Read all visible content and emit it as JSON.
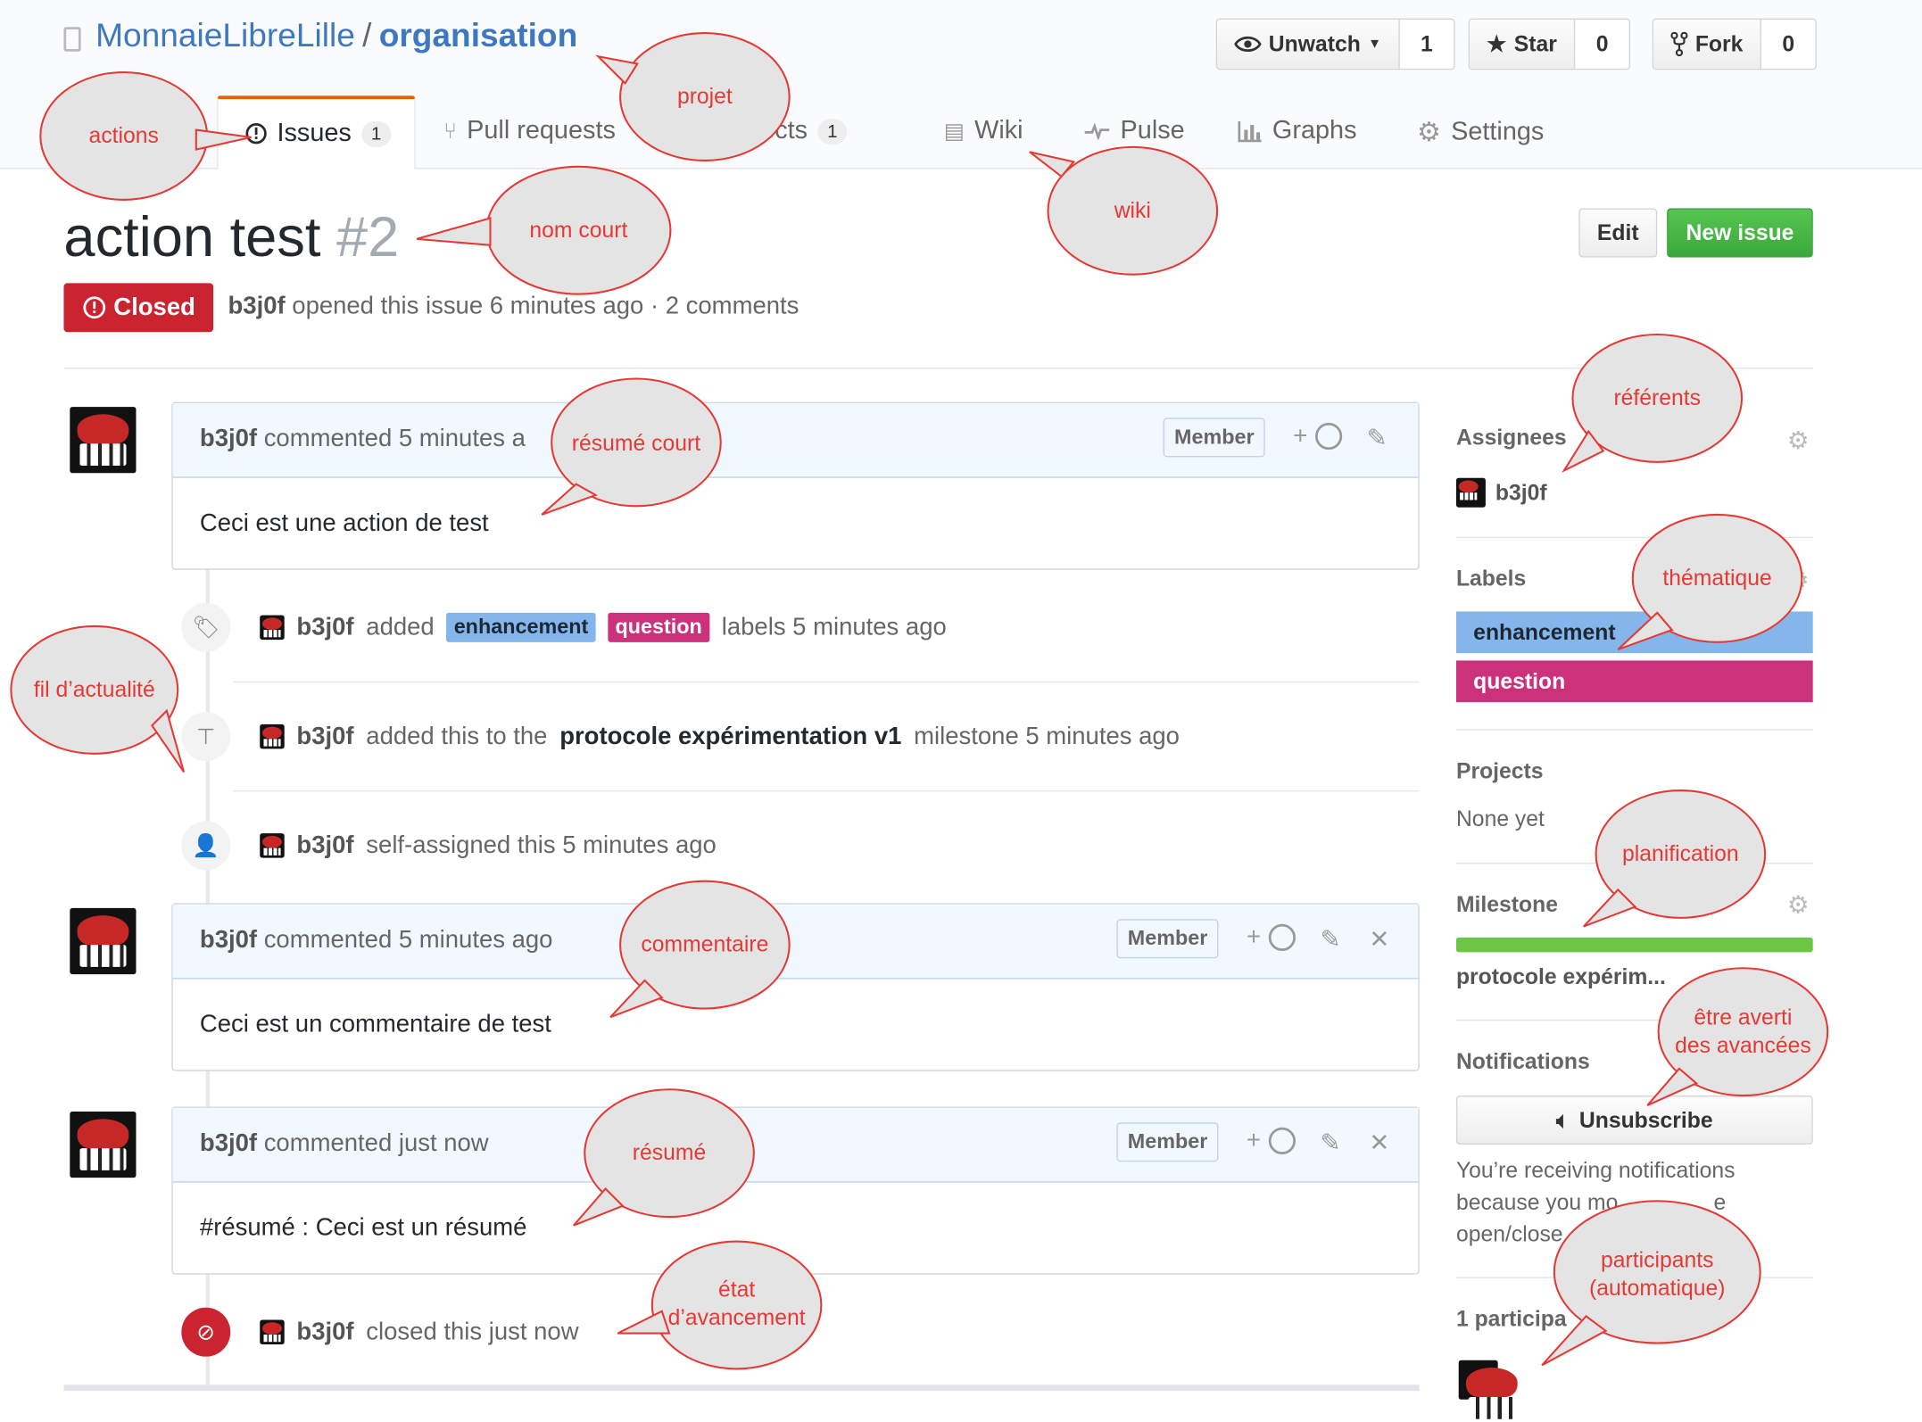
{
  "repo": {
    "owner": "MonnaieLibreLille",
    "separator": "/",
    "name": "organisation"
  },
  "actions": {
    "watch": {
      "label": "Unwatch",
      "count": "1"
    },
    "star": {
      "label": "Star",
      "count": "0"
    },
    "fork": {
      "label": "Fork",
      "count": "0"
    }
  },
  "tabs": [
    {
      "label": "Issues",
      "count": "1"
    },
    {
      "label": "Pull requests"
    },
    {
      "label": "Projects",
      "count": "1"
    },
    {
      "label": "Wiki"
    },
    {
      "label": "Pulse"
    },
    {
      "label": "Graphs"
    },
    {
      "label": "Settings"
    }
  ],
  "issue": {
    "title": "action test",
    "number": "#2",
    "state": "Closed",
    "author": "b3j0f",
    "meta": "opened this issue 6 minutes ago · 2 comments",
    "edit_label": "Edit",
    "new_label": "New issue"
  },
  "timeline": {
    "comment1": {
      "author": "b3j0f",
      "when": "commented 5 minutes a",
      "badge": "Member",
      "body": "Ceci est une action de test"
    },
    "labels_event": {
      "author": "b3j0f",
      "verb": "added",
      "label1": "enhancement",
      "label2": "question",
      "tail": "labels 5 minutes ago"
    },
    "milestone_event": {
      "author": "b3j0f",
      "verb": "added this to the",
      "milestone": "protocole expérimentation v1",
      "tail": "milestone 5 minutes ago"
    },
    "assign_event": {
      "author": "b3j0f",
      "tail": "self-assigned this 5 minutes ago"
    },
    "comment2": {
      "author": "b3j0f",
      "when": "commented 5 minutes ago",
      "badge": "Member",
      "body": "Ceci est un commentaire de test"
    },
    "comment3": {
      "author": "b3j0f",
      "when": "commented just now",
      "badge": "Member",
      "body": "#résumé : Ceci est un résumé"
    },
    "closed_event": {
      "author": "b3j0f",
      "tail": "closed this just now"
    }
  },
  "sidebar": {
    "assignees": {
      "heading": "Assignees",
      "user": "b3j0f"
    },
    "labels": {
      "heading": "Labels",
      "items": [
        "enhancement",
        "question"
      ]
    },
    "projects": {
      "heading": "Projects",
      "value": "None yet"
    },
    "milestone": {
      "heading": "Milestone",
      "value": "protocole expérim...",
      "progress": 1.0
    },
    "notifications": {
      "heading": "Notifications",
      "button": "Unsubscribe",
      "line1": "You’re receiving notifications",
      "line2": "because you mo",
      "line2_tail": "e",
      "line3": "open/close"
    },
    "participants": {
      "heading": "1 participa"
    }
  },
  "annotations": {
    "actions": "actions",
    "projet": "projet",
    "nom_court": "nom court",
    "wiki": "wiki",
    "resume_court": "résumé court",
    "referents": "référents",
    "thematique": "thématique",
    "fil_line": "fil d’actualité",
    "planification": "planification",
    "commentaire": "commentaire",
    "averti1": "être averti",
    "averti2": "des avancées",
    "resume": "résumé",
    "etat1": "état",
    "etat2": "d’avancement",
    "participants1": "participants",
    "participants2": "(automatique)"
  },
  "colors": {
    "link": "#4078c0",
    "closed": "#cb2431",
    "new_issue": "#3aa93a",
    "label_enhancement": "#84b6eb",
    "label_question": "#cc317c",
    "progress": "#6cc644",
    "annotation_text": "#e53935",
    "annotation_fill": "#e4e4e4"
  }
}
